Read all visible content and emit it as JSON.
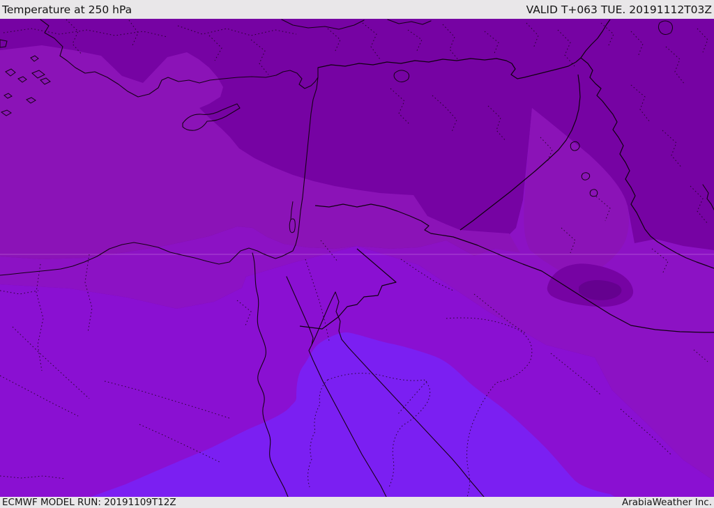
{
  "header": {
    "title": "Temperature at 250 hPa",
    "valid": "VALID T+063 TUE. 20191112T03Z"
  },
  "footer": {
    "model_run": "ECMWF MODEL RUN: 20191109T12Z",
    "credit": "ArabiaWeather Inc."
  },
  "map": {
    "palette": {
      "darkest": "#65018f",
      "dark": "#7603a3",
      "medium": "#8b13b7",
      "medium_bright": "#8c12c4",
      "bright": "#8a10d2",
      "brightest": "#7b1ff2"
    }
  }
}
